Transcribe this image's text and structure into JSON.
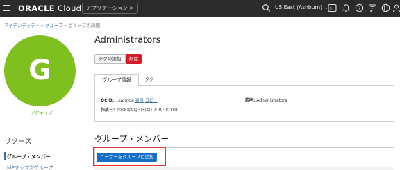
{
  "topbar": {
    "logo_brand": "ORACLE",
    "logo_product": " Cloud",
    "apps_button": "アプリケーション >",
    "region": "US East (Ashburn) ⌄"
  },
  "breadcrumb": {
    "item1": "アイデンティティ",
    "sep": " » ",
    "item2": "グループ",
    "current": "グループの詳細"
  },
  "group": {
    "avatar_letter": "G",
    "status": "アクティブ",
    "name": "Administrators"
  },
  "actions": {
    "add_tags": "タグの追加",
    "delete": "削除"
  },
  "tabs": {
    "group_info": "グループ情報",
    "tags": "タグ"
  },
  "info": {
    "ocid_label": "OCID:",
    "ocid_value": "...udqfda",
    "show_link": "表示",
    "copy_link": "コピー",
    "created_label": "作成日:",
    "created_value": "2018年9月3日(月) 7:09:00 UTC",
    "description_label": "説明:",
    "description_value": "Administrators"
  },
  "members": {
    "title": "グループ・メンバー",
    "add_user_button": "ユーザーをグループに追加"
  },
  "resources": {
    "title": "リソース",
    "items": [
      "グループ・メンバー",
      "IdPマップ済グループ"
    ]
  },
  "colors": {
    "avatar": "#7fbf1f",
    "status": "#6aa51a",
    "delete": "#d01d2a",
    "primary": "#1570c4",
    "highlight": "#e0343f"
  }
}
